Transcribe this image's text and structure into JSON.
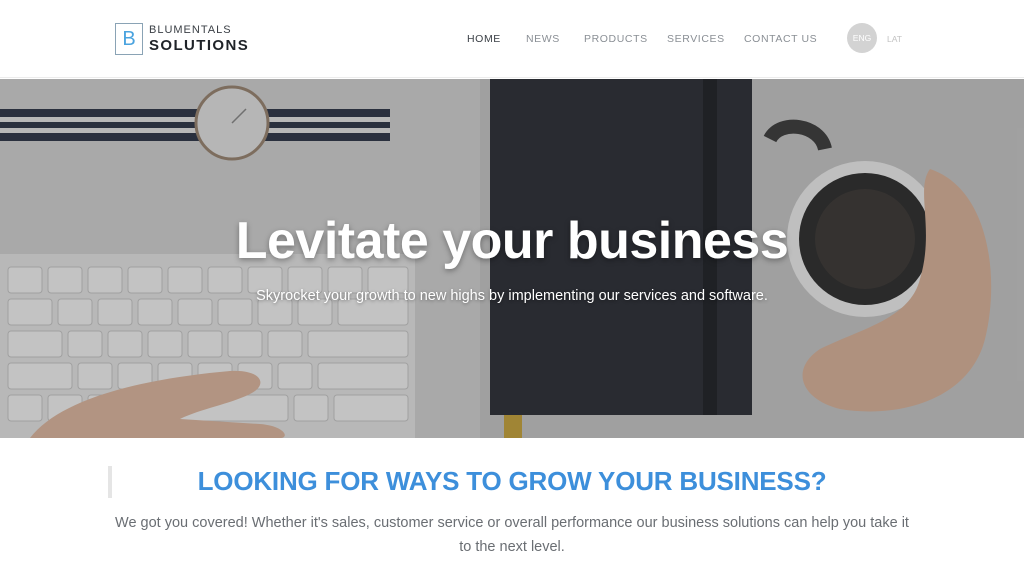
{
  "brand": {
    "mark": "B",
    "line1": "BLUMENTALS",
    "line2": "SOLUTIONS"
  },
  "nav": {
    "items": [
      {
        "label": "HOME",
        "active": true
      },
      {
        "label": "NEWS",
        "active": false
      },
      {
        "label": "PRODUCTS",
        "active": false
      },
      {
        "label": "SERVICES",
        "active": false
      },
      {
        "label": "CONTACT US",
        "active": false
      }
    ]
  },
  "language": {
    "active": "ENG",
    "other": "LAT"
  },
  "hero": {
    "title": "Levitate your business",
    "subtitle": "Skyrocket your growth to new highs by implementing our services and software."
  },
  "intro": {
    "heading": "LOOKING FOR WAYS TO GROW YOUR BUSINESS?",
    "text": "We got you covered! Whether it's sales, customer service or overall performance our business solutions can help you take it to the next level."
  },
  "colors": {
    "accent": "#3d8fdb",
    "nav_text": "#8a8f95",
    "nav_active": "#3a3f45",
    "lang_badge": "#d3d3d3"
  }
}
